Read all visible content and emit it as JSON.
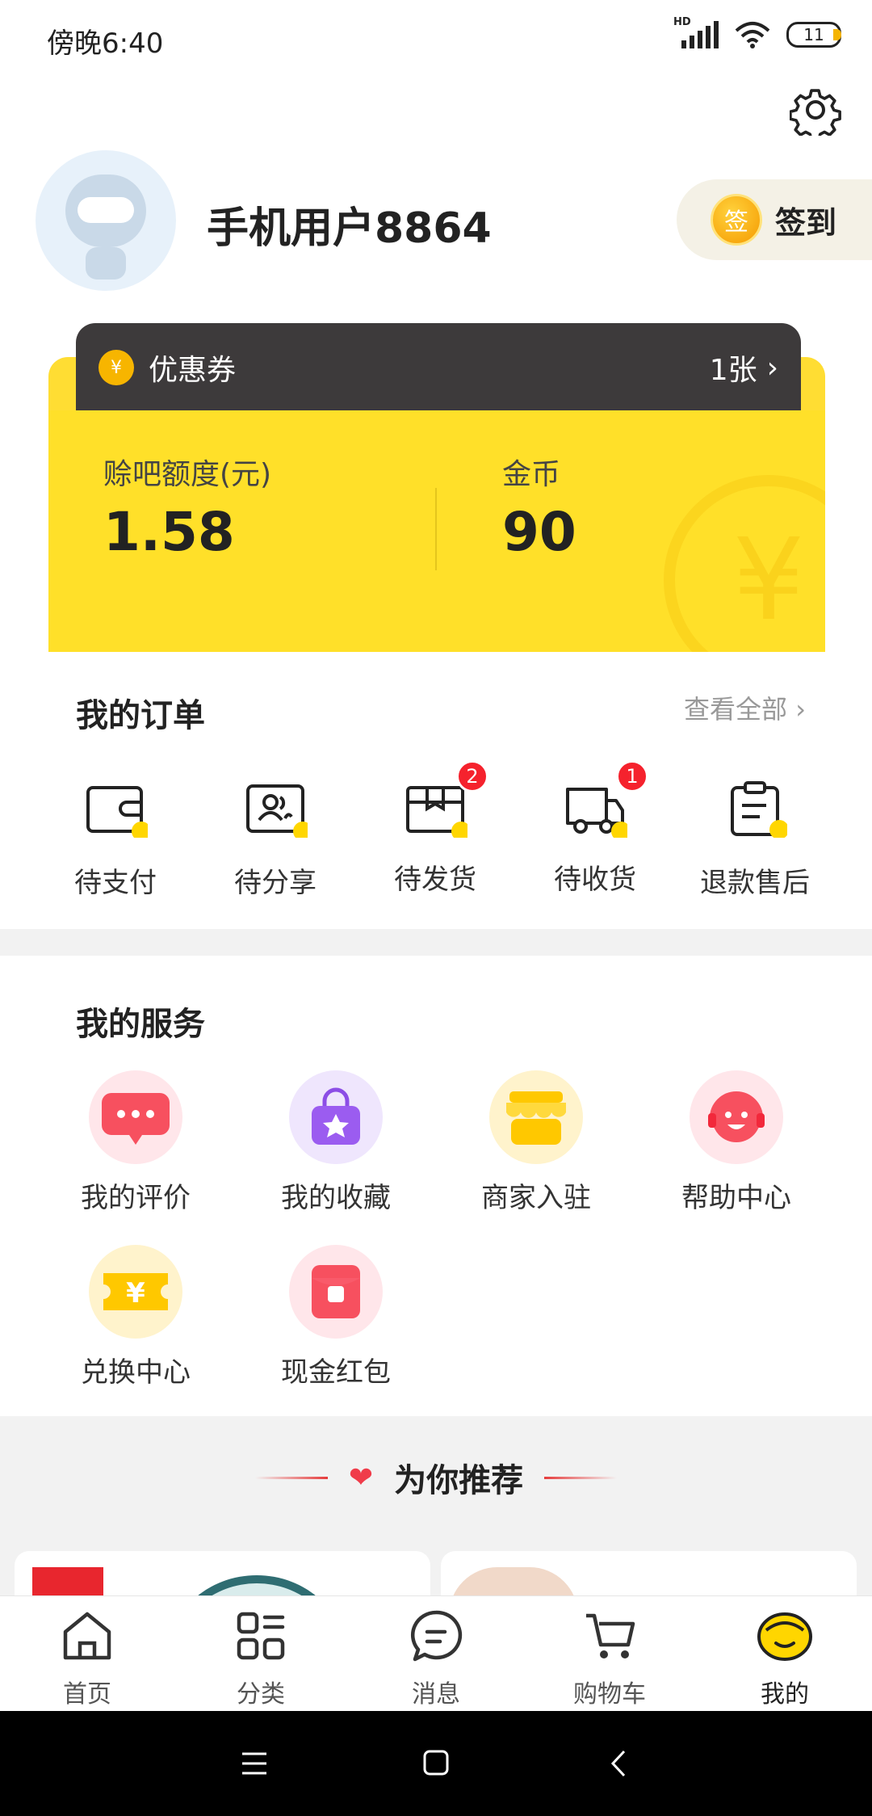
{
  "status": {
    "time": "傍晚6:40",
    "battery": "11"
  },
  "profile": {
    "username": "手机用户8864",
    "signin_label": "签到",
    "signin_coin": "签"
  },
  "card": {
    "coupon_label": "优惠券",
    "coupon_count": "1张",
    "credit_label": "赊吧额度(元)",
    "credit_value": "1.58",
    "gold_label": "金币",
    "gold_value": "90"
  },
  "orders": {
    "title": "我的订单",
    "view_all": "查看全部",
    "items": [
      {
        "label": "待支付",
        "icon": "wallet-icon"
      },
      {
        "label": "待分享",
        "icon": "share-people-icon"
      },
      {
        "label": "待发货",
        "icon": "package-icon",
        "badge": "2"
      },
      {
        "label": "待收货",
        "icon": "truck-icon",
        "badge": "1"
      },
      {
        "label": "退款售后",
        "icon": "clipboard-icon"
      }
    ]
  },
  "services": {
    "title": "我的服务",
    "items": [
      {
        "label": "我的评价",
        "icon": "comment-icon"
      },
      {
        "label": "我的收藏",
        "icon": "favorite-bag-icon"
      },
      {
        "label": "商家入驻",
        "icon": "store-icon"
      },
      {
        "label": "帮助中心",
        "icon": "support-headset-icon"
      },
      {
        "label": "兑换中心",
        "icon": "ticket-icon"
      },
      {
        "label": "现金红包",
        "icon": "red-envelope-icon"
      }
    ]
  },
  "recommend": {
    "title": "为你推荐"
  },
  "nav": {
    "items": [
      {
        "label": "首页",
        "icon": "home-icon"
      },
      {
        "label": "分类",
        "icon": "category-icon"
      },
      {
        "label": "消息",
        "icon": "message-icon"
      },
      {
        "label": "购物车",
        "icon": "cart-icon"
      },
      {
        "label": "我的",
        "icon": "profile-face-icon"
      }
    ]
  },
  "colors": {
    "accent": "#ffe029",
    "badge": "#f5222d",
    "dark": "#3d3a3b"
  }
}
